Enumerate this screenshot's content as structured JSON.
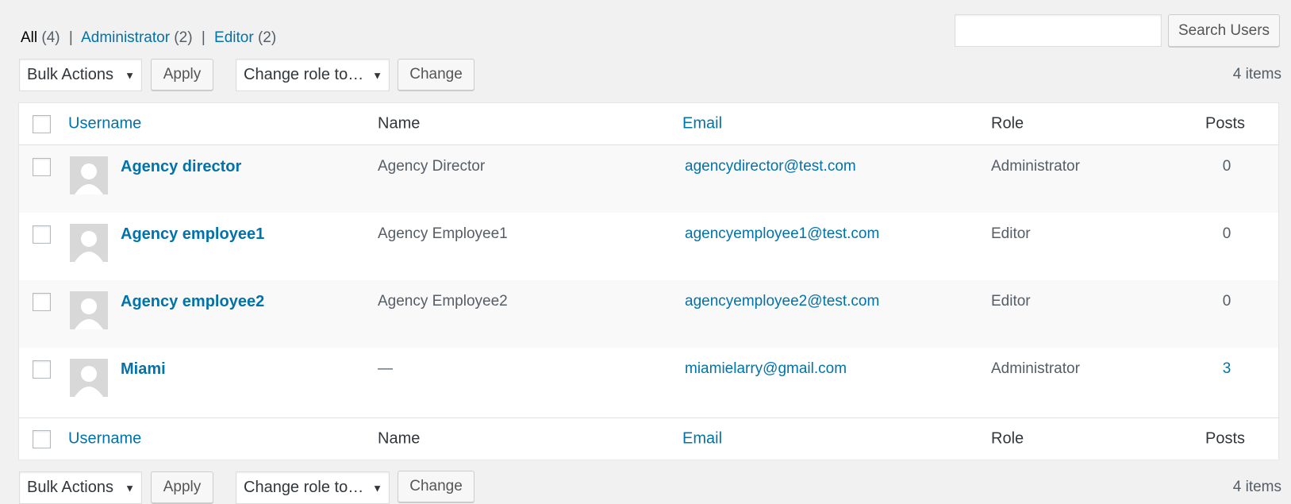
{
  "filters": {
    "all": {
      "label": "All",
      "count": "(4)"
    },
    "administrator": {
      "label": "Administrator",
      "count": "(2)"
    },
    "editor": {
      "label": "Editor",
      "count": "(2)"
    },
    "separator": "|"
  },
  "search": {
    "value": "",
    "button_label": "Search Users"
  },
  "top_nav": {
    "bulk_actions": "Bulk Actions",
    "apply": "Apply",
    "change_role": "Change role to…",
    "change": "Change",
    "items": "4 items"
  },
  "bottom_nav": {
    "bulk_actions": "Bulk Actions",
    "apply": "Apply",
    "change_role": "Change role to…",
    "change": "Change",
    "items": "4 items"
  },
  "columns": {
    "username": "Username",
    "name": "Name",
    "email": "Email",
    "role": "Role",
    "posts": "Posts"
  },
  "users": [
    {
      "username": "Agency director",
      "name": "Agency Director",
      "email": "agencydirector@test.com",
      "role": "Administrator",
      "posts": "0"
    },
    {
      "username": "Agency employee1",
      "name": "Agency Employee1",
      "email": "agencyemployee1@test.com",
      "role": "Editor",
      "posts": "0"
    },
    {
      "username": "Agency employee2",
      "name": "Agency Employee2",
      "email": "agencyemployee2@test.com",
      "role": "Editor",
      "posts": "0"
    },
    {
      "username": "Miami",
      "name": "—",
      "email": "miamielarry@gmail.com",
      "role": "Administrator",
      "posts": "3"
    }
  ],
  "colors": {
    "link": "#0073aa",
    "background": "#f1f1f1",
    "row_alt": "#f9f9f9",
    "avatar": "#d8d8d8"
  },
  "icons": {
    "select_arrow": "dropdown-arrow-icon",
    "avatar": "default-avatar-icon"
  }
}
